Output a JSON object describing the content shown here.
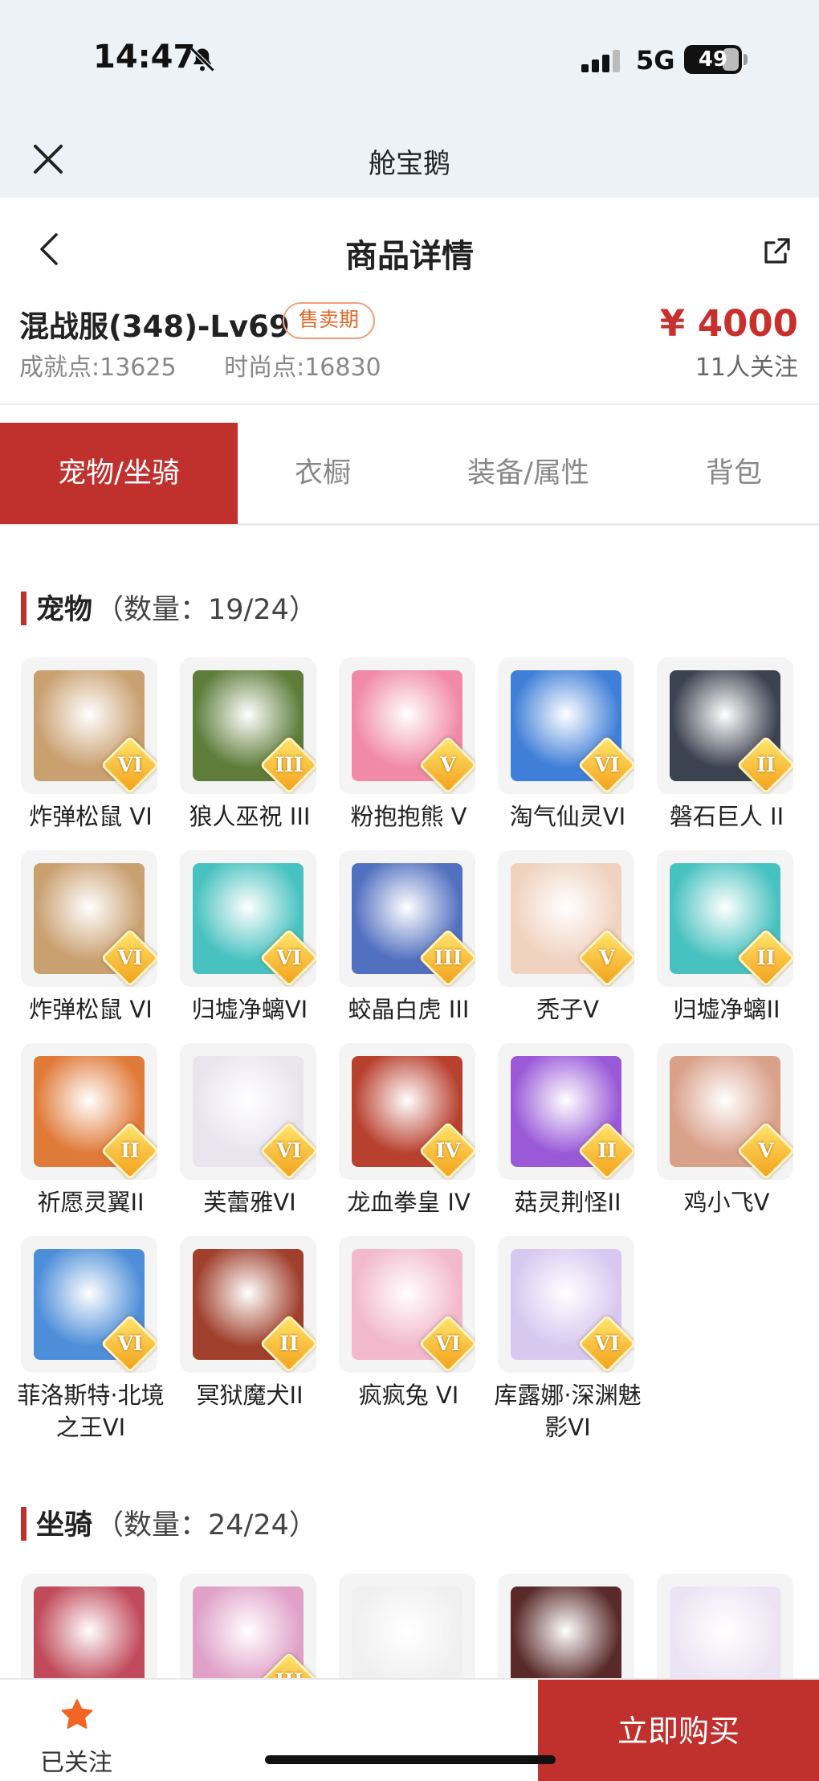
{
  "status": {
    "time": "14:47",
    "network": "5G",
    "battery": "49"
  },
  "miniapp": {
    "title": "舱宝鹅"
  },
  "nav": {
    "title": "商品详情"
  },
  "product": {
    "server": "混战服(348)-Lv69",
    "badge": "售卖期",
    "price": "¥ 4000",
    "achievement": "成就点:13625",
    "fashion": "时尚点:16830",
    "followers": "11人关注"
  },
  "tabs": [
    "宠物/坐骑",
    "衣橱",
    "装备/属性",
    "背包"
  ],
  "pets": {
    "title": "宠物",
    "count": "（数量：19/24）",
    "items": [
      {
        "name": "炸弹松鼠 VI",
        "rank": "VI",
        "color": "#c9a070"
      },
      {
        "name": "狼人巫祝 III",
        "rank": "III",
        "color": "#5e7d3a"
      },
      {
        "name": "粉抱抱熊 V",
        "rank": "V",
        "color": "#f08aa8"
      },
      {
        "name": "淘气仙灵VI",
        "rank": "VI",
        "color": "#3f7fd8"
      },
      {
        "name": "磐石巨人 II",
        "rank": "II",
        "color": "#3b4250"
      },
      {
        "name": "炸弹松鼠 VI",
        "rank": "VI",
        "color": "#c9a070"
      },
      {
        "name": "归墟净螭VI",
        "rank": "VI",
        "color": "#48c2c0"
      },
      {
        "name": "蛟晶白虎 III",
        "rank": "III",
        "color": "#5270c0"
      },
      {
        "name": "秃子V",
        "rank": "V",
        "color": "#f0d2c0"
      },
      {
        "name": "归墟净螭II",
        "rank": "II",
        "color": "#48c2c0"
      },
      {
        "name": "祈愿灵翼II",
        "rank": "II",
        "color": "#e07a38"
      },
      {
        "name": "芙蕾雅VI",
        "rank": "VI",
        "color": "#e8e4f0"
      },
      {
        "name": "龙血拳皇 IV",
        "rank": "IV",
        "color": "#b8402e"
      },
      {
        "name": "菇灵荆怪II",
        "rank": "II",
        "color": "#9a5ad8"
      },
      {
        "name": "鸡小飞V",
        "rank": "V",
        "color": "#d9a08a"
      },
      {
        "name": "菲洛斯特·北境之王VI",
        "rank": "VI",
        "color": "#4d8ed8"
      },
      {
        "name": "冥狱魔犬II",
        "rank": "II",
        "color": "#a0402c"
      },
      {
        "name": "疯疯兔 VI",
        "rank": "VI",
        "color": "#f2b8cc"
      },
      {
        "name": "库露娜·深渊魅影VI",
        "rank": "VI",
        "color": "#d8c8f0"
      }
    ]
  },
  "mounts": {
    "title": "坐骑",
    "count": "（数量：24/24）",
    "items": [
      {
        "name": "",
        "rank": "",
        "color": "#c04a5a"
      },
      {
        "name": "",
        "rank": "III",
        "color": "#e0a0c8"
      },
      {
        "name": "",
        "rank": "",
        "color": "#f0f0f0"
      },
      {
        "name": "",
        "rank": "",
        "color": "#5a2a2a"
      },
      {
        "name": "",
        "rank": "",
        "color": "#ece4f4"
      }
    ]
  },
  "footer": {
    "follow": "已关注",
    "buy": "立即购买"
  },
  "colors": {
    "accent": "#c0302d",
    "price": "#c8302e",
    "badge": "#e06a2a"
  }
}
